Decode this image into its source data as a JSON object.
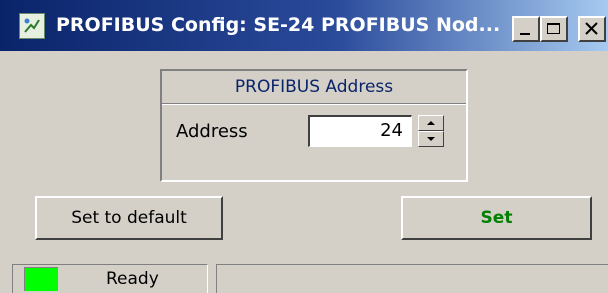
{
  "window": {
    "title": "PROFIBUS Config: SE-24 PROFIBUS Nod..."
  },
  "address_group": {
    "title": "PROFIBUS Address",
    "label": "Address",
    "value": "24"
  },
  "buttons": {
    "default_label": "Set to default",
    "set_label": "Set"
  },
  "status": {
    "text": "Ready",
    "led_color": "#00ff00"
  },
  "colors": {
    "titlebar_start": "#0a246a",
    "set_label": "#008000"
  }
}
